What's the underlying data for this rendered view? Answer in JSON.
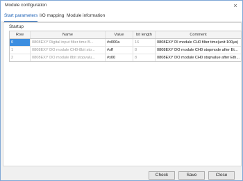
{
  "window": {
    "title": "Module configuration",
    "close_glyph": "×"
  },
  "tabs": [
    {
      "label": "Start parameters",
      "active": true
    },
    {
      "label": "I/O mapping",
      "active": false
    },
    {
      "label": "Module information",
      "active": false
    }
  ],
  "startup": {
    "group_label": "Startup",
    "columns": [
      "Row",
      "Name",
      "Value",
      "bit length",
      "Comment"
    ],
    "rows": [
      {
        "row": "0",
        "name": "0808EXY Digital input filter time B...",
        "value": "#x000a",
        "bit_length": "16",
        "comment": "0808EXY DI module CH0 filter time(unit:100μs)"
      },
      {
        "row": "1",
        "name": "0808EXY DO module CH0-8bit sto...",
        "value": "#xff",
        "bit_length": "8",
        "comment": "0808EXY DO module CH0 stopmode after Et..."
      },
      {
        "row": "2",
        "name": "0808EXY DO module 8bit stopvalu...",
        "value": "#x00",
        "bit_length": "8",
        "comment": "0808EXY DO module CH0 stopvalue after Eth..."
      }
    ]
  },
  "buttons": {
    "check": "Check",
    "save": "Save",
    "close": "Close"
  },
  "colors": {
    "accent": "#1a5fb4",
    "selection": "#3d8ee0",
    "border": "#7fa7d6"
  }
}
